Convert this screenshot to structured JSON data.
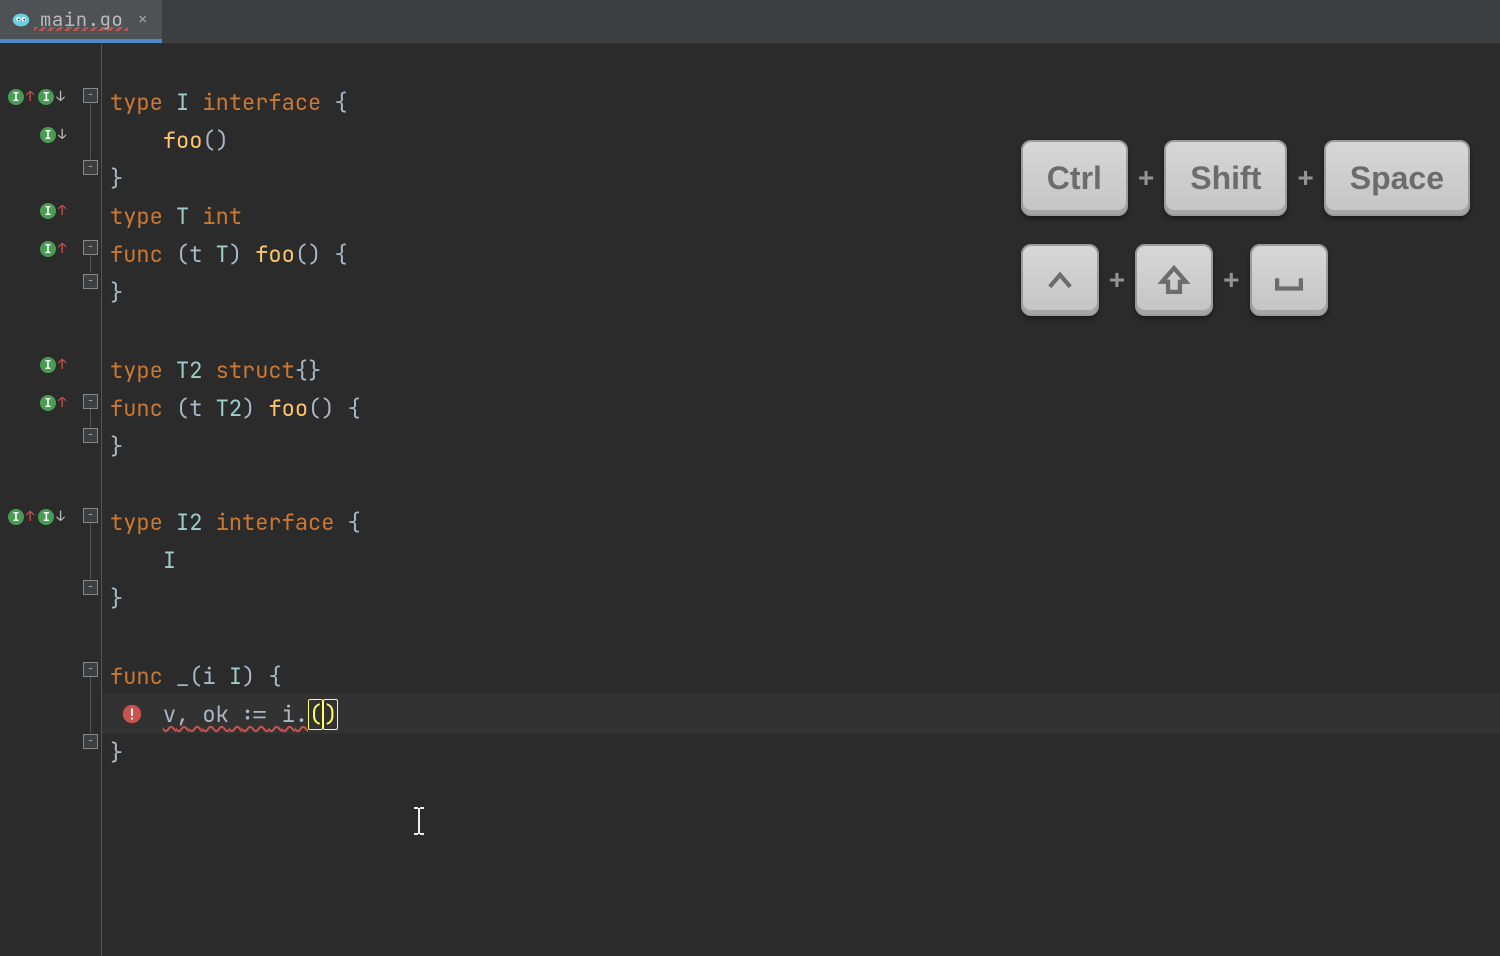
{
  "tab": {
    "filename": "main.go"
  },
  "code": {
    "l1": {
      "kw": "type",
      "name": "I",
      "iface": "interface",
      "open": "{"
    },
    "l2": {
      "fn": "foo",
      "parens": "()"
    },
    "l3": {
      "close": "}"
    },
    "l4": {
      "kw": "type",
      "name": "T",
      "typ": "int"
    },
    "l5": {
      "kw": "func",
      "lpar": "(",
      "recv": "t",
      "rtyp": "T",
      "rpar": ")",
      "fn": "foo",
      "parens": "()",
      "open": "{"
    },
    "l6": {
      "close": "}"
    },
    "l8": {
      "kw": "type",
      "name": "T2",
      "struct": "struct",
      "parens": "{}"
    },
    "l9": {
      "kw": "func",
      "lpar": "(",
      "recv": "t",
      "rtyp": "T2",
      "rpar": ")",
      "fn": "foo",
      "parens": "()",
      "open": "{"
    },
    "l10": {
      "close": "}"
    },
    "l12": {
      "kw": "type",
      "name": "I2",
      "iface": "interface",
      "open": "{"
    },
    "l13": {
      "embed": "I"
    },
    "l14": {
      "close": "}"
    },
    "l16": {
      "kw": "func",
      "blank": "_",
      "lpar": "(",
      "param": "i",
      "ptyp": "I",
      "rpar": ")",
      "open": "{"
    },
    "l17": {
      "v": "v",
      "comma": ",",
      "ok": "ok",
      "assign": ":=",
      "i": "i",
      "dot": ".",
      "lp": "(",
      "rp": ")"
    },
    "l18": {
      "close": "}"
    }
  },
  "shortcut": {
    "row1": [
      "Ctrl",
      "Shift",
      "Space"
    ],
    "row2_icons": [
      "ctrl",
      "shift",
      "space"
    ]
  }
}
